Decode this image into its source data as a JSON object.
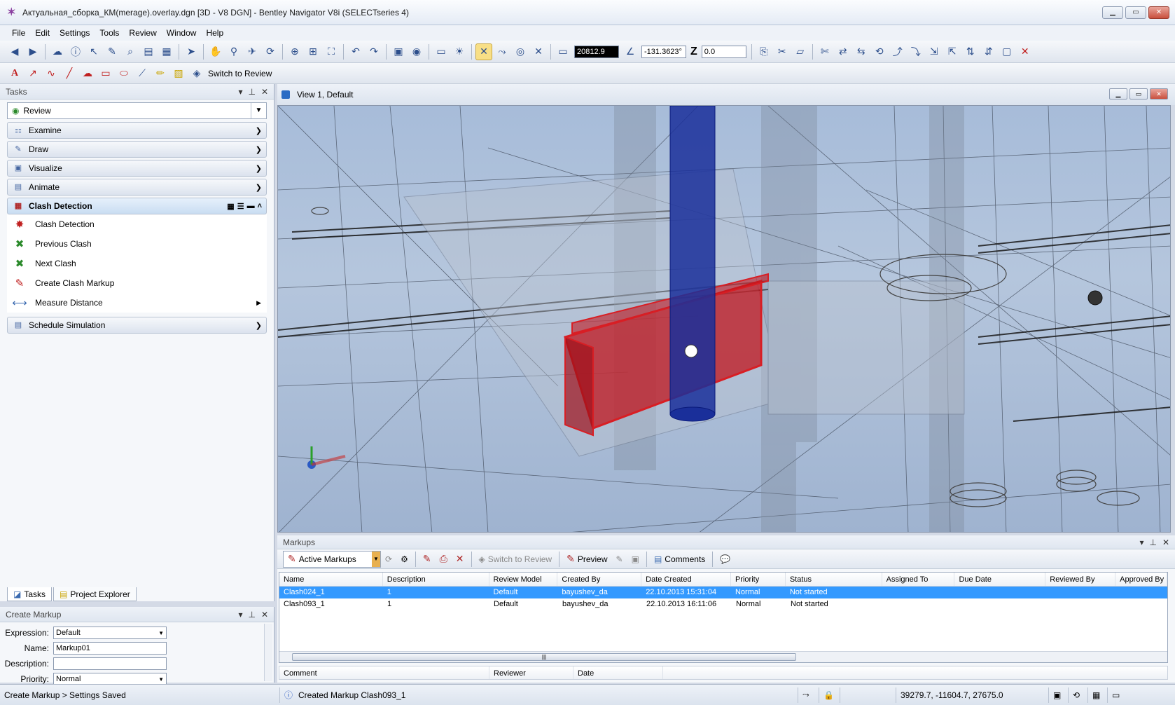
{
  "window": {
    "title": "Актуальная_сборка_КМ(merage).overlay.dgn [3D - V8 DGN] - Bentley Navigator V8i (SELECTseries 4)"
  },
  "menu": [
    "File",
    "Edit",
    "Settings",
    "Tools",
    "Review",
    "Window",
    "Help"
  ],
  "toolbar": {
    "coord_x": "20812.9",
    "angle": "-131.3623°",
    "z_label": "Z",
    "z_value": "0.0",
    "switch_review": "Switch to Review"
  },
  "tasks": {
    "title": "Tasks",
    "selected_task": "Review",
    "groups": [
      "Examine",
      "Draw",
      "Visualize",
      "Animate"
    ],
    "clash_group": "Clash Detection",
    "clash_items": [
      "Clash Detection",
      "Previous Clash",
      "Next Clash",
      "Create Clash Markup",
      "Measure Distance"
    ],
    "schedule_group": "Schedule Simulation",
    "tab_tasks": "Tasks",
    "tab_project": "Project Explorer"
  },
  "create_markup": {
    "title": "Create Markup",
    "expression_label": "Expression:",
    "expression_value": "Default",
    "name_label": "Name:",
    "name_value": "Markup01",
    "description_label": "Description:",
    "description_value": "",
    "priority_label": "Priority:",
    "priority_value": "Normal"
  },
  "view": {
    "title": "View 1, Default"
  },
  "markups": {
    "title": "Markups",
    "active_label": "Active Markups",
    "switch_review": "Switch to Review",
    "preview": "Preview",
    "comments": "Comments",
    "columns": [
      "Name",
      "Description",
      "Review Model",
      "Created By",
      "Date Created",
      "Priority",
      "Status",
      "Assigned To",
      "Due Date",
      "Reviewed By",
      "Approved By"
    ],
    "rows": [
      [
        "Clash024_1",
        "1",
        "Default",
        "bayushev_da",
        "22.10.2013 15:31:04",
        "Normal",
        "Not started",
        "",
        "",
        "",
        ""
      ],
      [
        "Clash093_1",
        "1",
        "Default",
        "bayushev_da",
        "22.10.2013 16:11:06",
        "Normal",
        "Not started",
        "",
        "",
        "",
        ""
      ]
    ],
    "comment_columns": [
      "Comment",
      "Reviewer",
      "Date"
    ]
  },
  "status": {
    "left": "Create Markup > Settings Saved",
    "message": "Created Markup Clash093_1",
    "coords": "39279.7, -11604.7, 27675.0"
  },
  "colors": {
    "clash_red": "#c0141c",
    "pipe_blue": "#1a2f9a",
    "selection": "#3399ff"
  }
}
